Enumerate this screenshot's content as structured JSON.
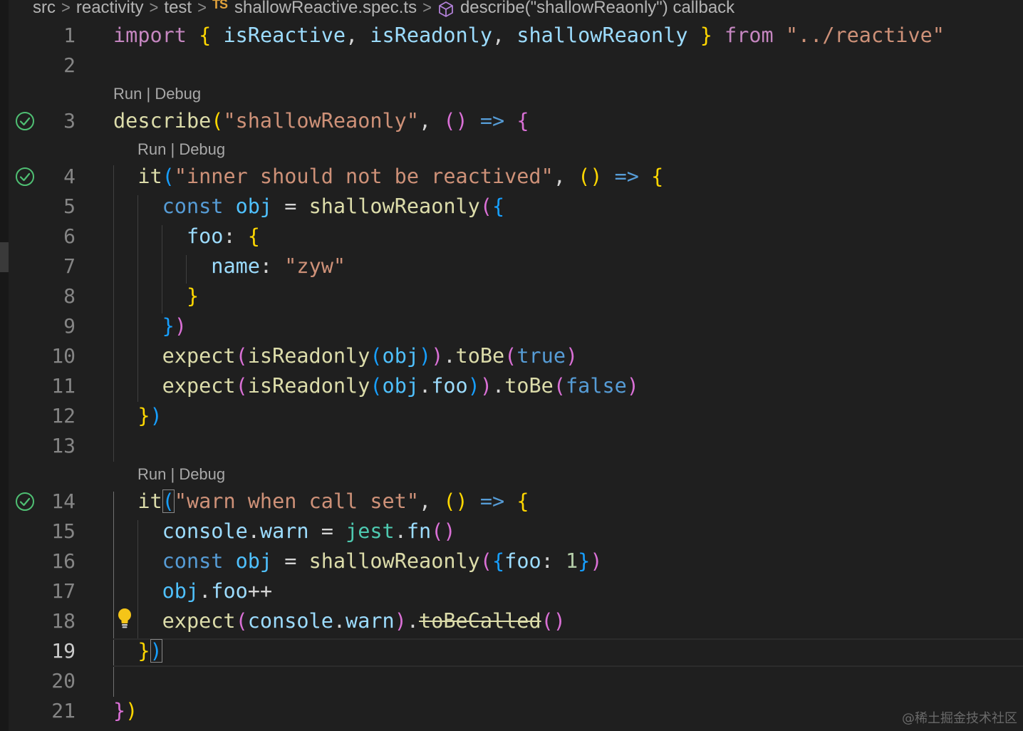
{
  "breadcrumb": {
    "items": [
      "src",
      "reactivity",
      "test",
      "shallowReactive.spec.ts",
      "describe(\"shallowReaonly\") callback"
    ],
    "file_badge": "TS",
    "file_icon": "typescript-icon",
    "symbol_icon": "cube-icon"
  },
  "codelens": {
    "run": "Run",
    "separator": " | ",
    "debug": "Debug"
  },
  "gutter": {
    "line_numbers": [
      "1",
      "2",
      "3",
      "4",
      "5",
      "6",
      "7",
      "8",
      "9",
      "10",
      "11",
      "12",
      "13",
      "14",
      "15",
      "16",
      "17",
      "18",
      "19",
      "20",
      "21"
    ],
    "active_line": "19",
    "test_status_icon": "check-circle-icon",
    "lightbulb_icon": "lightbulb-icon"
  },
  "colors": {
    "background": "#1f1f1f",
    "keyword": "#c586c0",
    "string": "#ce9178",
    "function": "#dcdcaa",
    "variable": "#9cdcfe",
    "bracket_gold": "#ffd700",
    "bracket_pink": "#da70d6",
    "bracket_blue": "#179fff",
    "pass": "#4fbf73",
    "lightbulb": "#f5c518"
  },
  "code": {
    "l1": [
      "import",
      "{",
      "isReactive",
      "isReadonly",
      "shallowReaonly",
      "}",
      "from",
      "\"../reactive\""
    ],
    "l3": [
      "describe",
      "(",
      "\"shallowReaonly\"",
      "()",
      "=>",
      "{"
    ],
    "l4": [
      "it",
      "(",
      "\"inner should not be reactived\"",
      "()",
      "=>",
      "{"
    ],
    "l5": [
      "const",
      "obj",
      "=",
      "shallowReaonly",
      "(",
      "{"
    ],
    "l6": [
      "foo",
      "{"
    ],
    "l7": [
      "name",
      "\"zyw\""
    ],
    "l8": [
      "}"
    ],
    "l9": [
      "}",
      ")"
    ],
    "l10": [
      "expect",
      "(",
      "isReadonly",
      "(",
      "obj",
      ")",
      ")",
      "toBe",
      "(",
      "true",
      ")"
    ],
    "l11": [
      "expect",
      "(",
      "isReadonly",
      "(",
      "obj",
      "foo",
      ")",
      ")",
      "toBe",
      "(",
      "false",
      ")"
    ],
    "l12": [
      "}",
      ")"
    ],
    "l14": [
      "it",
      "(",
      "\"warn when call set\"",
      "()",
      "=>",
      "{"
    ],
    "l15": [
      "console",
      "warn",
      "=",
      "jest",
      "fn",
      "()"
    ],
    "l16": [
      "const",
      "obj",
      "=",
      "shallowReaonly",
      "(",
      "{",
      "foo",
      "1",
      "}",
      ")"
    ],
    "l17": [
      "obj",
      "foo",
      "++"
    ],
    "l18": [
      "expect",
      "(",
      "console",
      "warn",
      ")",
      "toBeCalled",
      "()"
    ],
    "l19": [
      "}",
      ")"
    ],
    "l21": [
      "}",
      ")"
    ]
  },
  "watermark": "@稀土掘金技术社区"
}
